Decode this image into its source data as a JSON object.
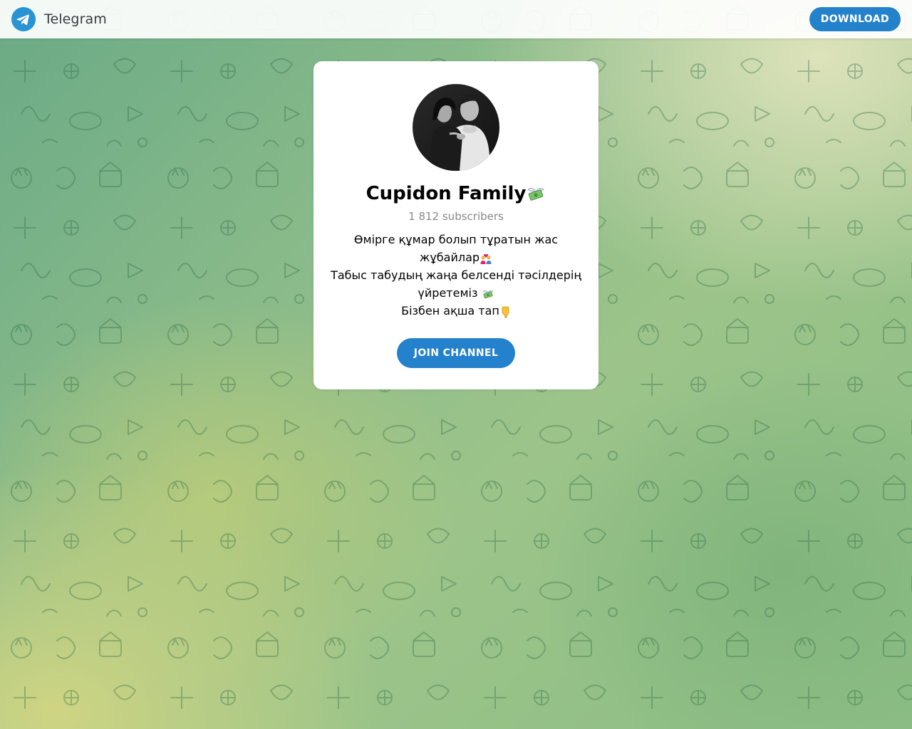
{
  "header": {
    "app_name": "Telegram",
    "download_label": "DOWNLOAD"
  },
  "channel": {
    "title": "Cupidon Family",
    "subscribers": "1 812 subscribers",
    "description": {
      "line1": "Өмірге құмар болып тұратын жас",
      "line2": "жұбайлар",
      "line3": "Табыс табудың жаңа белсенді тәсілдерің",
      "line4": "үйретеміз",
      "line5": "Бізбен ақша тап"
    },
    "join_label": "JOIN CHANNEL"
  },
  "icons": {
    "logo": "telegram-plane-icon",
    "title_emoji": "money-with-wings-icon",
    "couple_emoji": "couple-with-heart-icon",
    "money_emoji": "money-with-wings-icon",
    "pointing_emoji": "pointing-down-icon"
  },
  "colors": {
    "accent": "#2481cc",
    "subtle_text": "#888888"
  }
}
